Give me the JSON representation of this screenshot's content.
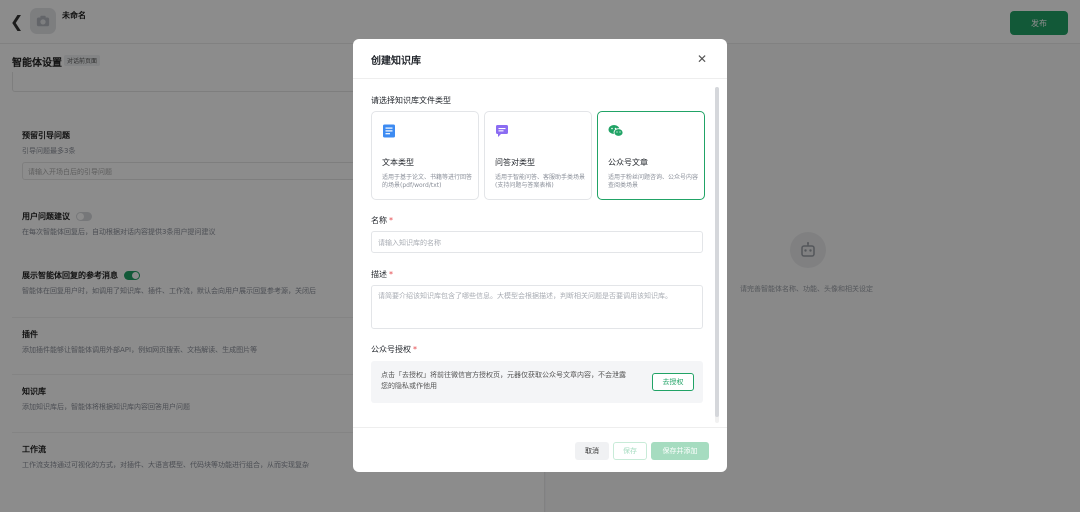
{
  "topbar": {
    "agent_name": "未命名",
    "publish_label": "发布"
  },
  "left": {
    "settings_title": "智能体设置",
    "settings_tag": "对话前页面",
    "sections": [
      {
        "title": "预留引导问题",
        "desc": "引导问题最多3条",
        "input_placeholder": "请输入开场白后的引导问题"
      },
      {
        "title": "用户问题建议",
        "desc": "在每次智能体回复后，自动根据对话内容提供3条用户提问建议"
      },
      {
        "title": "展示智能体回复的参考消息",
        "desc": "智能体在回复用户时，如调用了知识库、插件、工作流，默认会向用户展示回复参考源，关闭后"
      },
      {
        "title": "插件",
        "desc": "添加插件能够让智能体调用外部API，例如网页搜索、文档解读、生成图片等"
      },
      {
        "title": "知识库",
        "desc": "添加知识库后，智能体将根据知识库内容回答用户问题"
      },
      {
        "title": "工作流",
        "desc": "工作流支持通过可视化的方式，对插件、大语言模型、代码块等功能进行组合，从而实现复杂"
      }
    ]
  },
  "right": {
    "hint": "请完善智能体名称、功能、头像和相关设定"
  },
  "modal": {
    "title": "创建知识库",
    "type_label": "请选择知识库文件类型",
    "types": [
      {
        "title": "文本类型",
        "desc": "适用于基于论文、书籍等进行回答的场景(pdf/word/txt)"
      },
      {
        "title": "问答对类型",
        "desc": "适用于智能问答、客服助手类场景(支持问题与答案表格)"
      },
      {
        "title": "公众号文章",
        "desc": "适用于粉丝问题咨询、公众号内容查阅类场景"
      }
    ],
    "name_label": "名称",
    "name_placeholder": "请输入知识库的名称",
    "desc_label": "描述",
    "desc_placeholder": "请简要介绍该知识库包含了哪些信息。大模型会根据描述，判断相关问题是否要调用该知识库。",
    "auth_label": "公众号授权",
    "auth_text": "点击「去授权」将前往微信官方授权页，元器仅获取公众号文章内容，不会泄露您的隐私或作他用",
    "auth_button": "去授权",
    "required_mark": "*",
    "footer": {
      "cancel": "取消",
      "save": "保存",
      "save_add": "保存并添加"
    }
  },
  "colors": {
    "accent": "#21a366",
    "text_icon": "#3d8bf2",
    "qa_icon": "#8b6cf2",
    "wechat_icon": "#21a366"
  }
}
